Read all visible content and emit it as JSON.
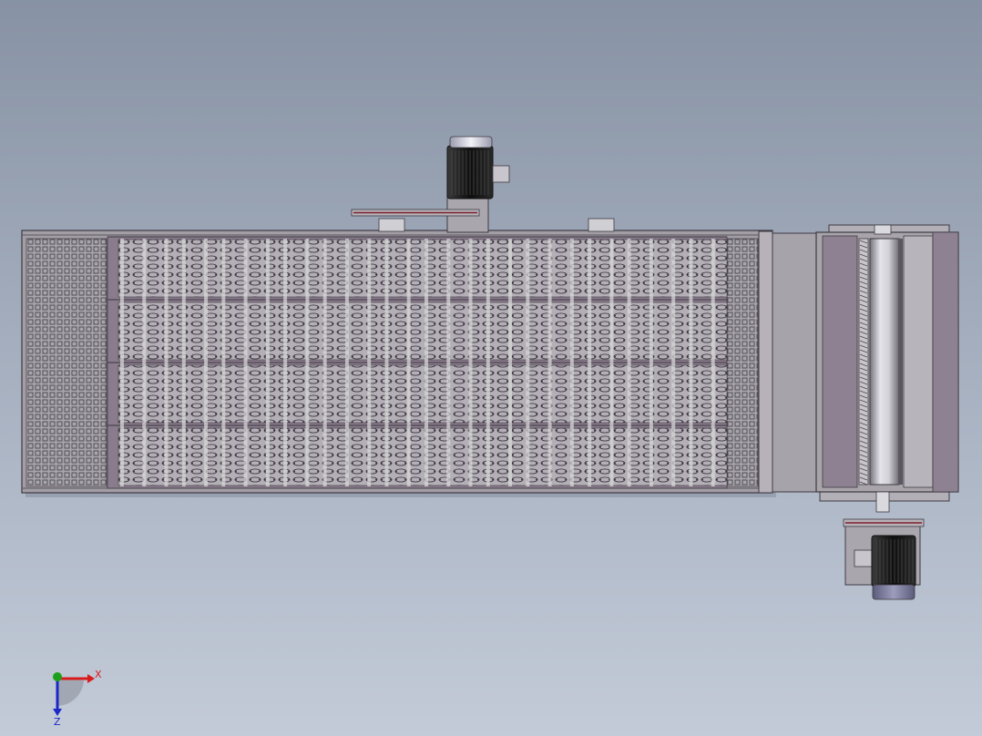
{
  "view": {
    "background_top": "#8792a4",
    "background_bottom": "#c3cbd8"
  },
  "conveyor": {
    "frame_color": "#9f9aa0",
    "belt_color": "#8a7c8c",
    "chain_link_color": "#d6d6d6",
    "belt_rows": 4,
    "chain_columns": 30
  },
  "drive_motor_top": {
    "body_color": "#1a1a1a",
    "cap_color": "#d9d9e3",
    "belt_color": "#7a1f2b"
  },
  "drive_motor_bottom": {
    "body_color": "#1a1a1a",
    "cap_color": "#7c7c99",
    "belt_color": "#7a1f2b"
  },
  "roller_unit": {
    "housing_color": "#a8a4aa",
    "roller_color": "#bfbfc4"
  },
  "triad": {
    "x_label": "X",
    "z_label": "Z",
    "x_color": "#d81c1c",
    "y_color": "#1ca01c",
    "z_color": "#1c28c8"
  }
}
